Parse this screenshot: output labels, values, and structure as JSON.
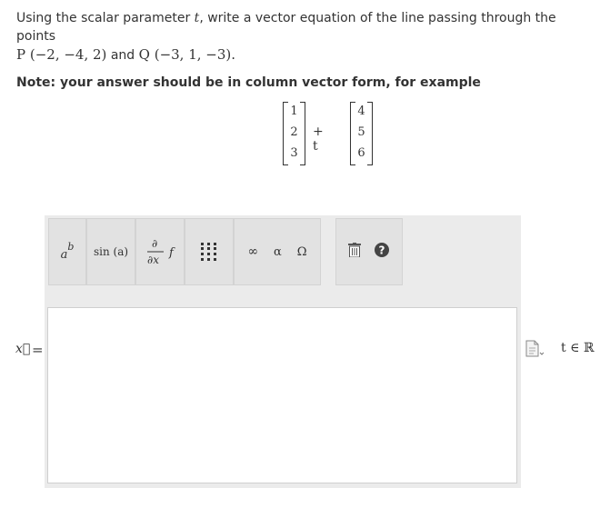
{
  "question": {
    "prefix": "Using the scalar parameter ",
    "param": "t",
    "suffix": ", write a vector equation of the line passing through the points",
    "point_p": "P (−2, −4, 2)",
    "and": " and ",
    "point_q": "Q (−3, 1, −3)",
    "end": "."
  },
  "note": "Note: your answer should be in column vector form, for example",
  "example": {
    "vector1": [
      "1",
      "2",
      "3"
    ],
    "plus_t": "+ t",
    "vector2": [
      "4",
      "5",
      "6"
    ]
  },
  "toolbar": {
    "superscript_label": "ab",
    "sin_label": "sin (a)",
    "partial_label": "∂/∂x f",
    "infinity_label": "∞",
    "alpha_label": "α",
    "omega_label": "Ω",
    "help_label": "?"
  },
  "answer": {
    "vector_label": "x⃗",
    "equals": "=",
    "value": "",
    "domain": "t ∈ ℝ"
  },
  "icons": {
    "matrix": "matrix-icon",
    "trash": "trash-icon",
    "help": "help-icon",
    "paste": "paste-icon"
  },
  "colors": {
    "toolbar_bg": "#ebebeb",
    "help_circle": "#444444"
  }
}
